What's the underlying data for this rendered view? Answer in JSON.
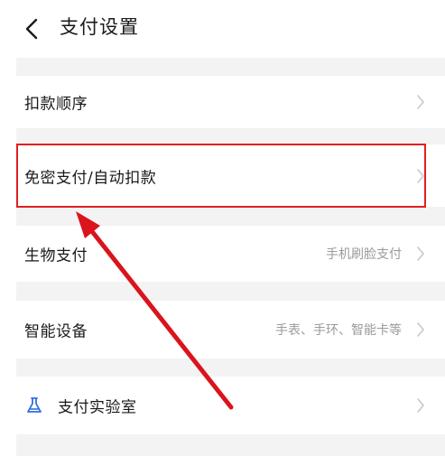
{
  "header": {
    "back_icon": "chevron-left-icon",
    "title": "支付设置"
  },
  "rows": [
    {
      "label": "扣款顺序",
      "value": "",
      "icon": "chevron-right-icon"
    },
    {
      "label": "免密支付/自动扣款",
      "value": "",
      "icon": "chevron-right-icon"
    },
    {
      "label": "生物支付",
      "value": "手机刷脸支付",
      "icon": "chevron-right-icon"
    },
    {
      "label": "智能设备",
      "value": "手表、手环、智能卡等",
      "icon": "chevron-right-icon"
    },
    {
      "label": "支付实验室",
      "value": "",
      "icon": "chevron-right-icon",
      "leading_icon": "flask-icon"
    }
  ],
  "annotation": {
    "highlight_color": "#e02020",
    "arrow_color": "#d9141c"
  },
  "colors": {
    "background": "#ffffff",
    "separator": "#f3f3f3",
    "text": "#1a1a1a",
    "secondary_text": "#9a9a9a",
    "chevron": "#c8c8c8",
    "accent_blue": "#2f6fe0"
  }
}
